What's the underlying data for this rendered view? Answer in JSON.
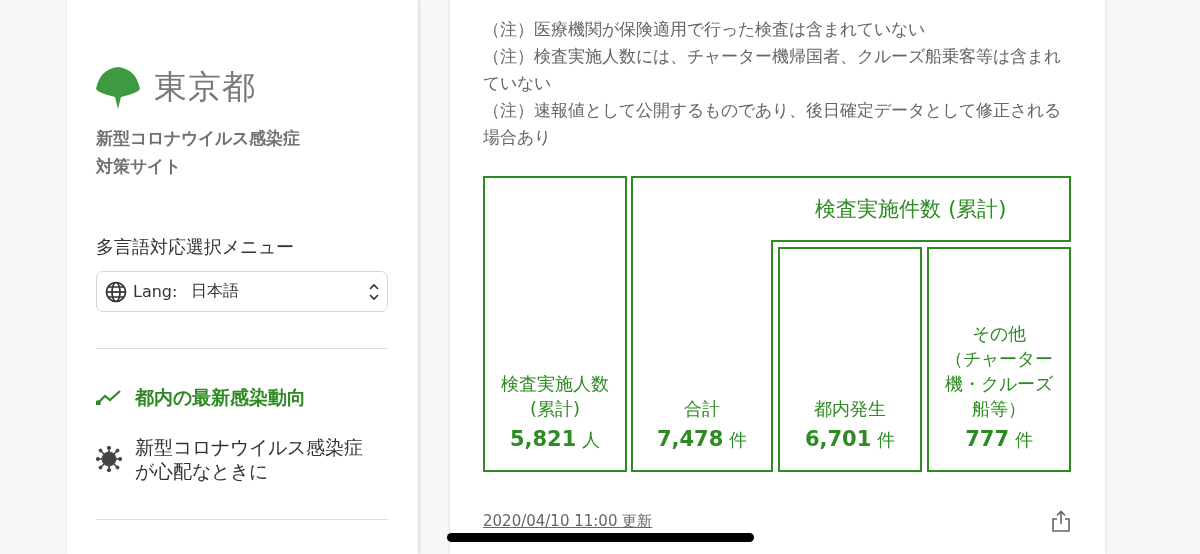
{
  "sidebar": {
    "logo_text": "東京都",
    "site_title_lines": [
      "新型コロナウイルス感染症",
      "対策サイト"
    ],
    "language_menu": {
      "label": "多言語対応選択メニュー",
      "prefix": "Lang:",
      "value": "日本語"
    },
    "nav_items": [
      {
        "label": "都内の最新感染動向",
        "kind": "trend",
        "selected": true
      },
      {
        "label": "新型コロナウイルス感染症が心配なときに",
        "kind": "virus",
        "selected": false
      }
    ]
  },
  "card": {
    "notes": [
      "（注）医療機関が保険適用で行った検査は含まれていない",
      "（注）検査実施人数には、チャーター機帰国者、クルーズ船乗客等は含まれていない",
      "（注）速報値として公開するものであり、後日確定データとして修正される場合あり"
    ],
    "people": {
      "label_lines": [
        "検査実施人数",
        "(累計)"
      ],
      "value": "5,821",
      "unit": "人"
    },
    "group_title": "検査実施件数 (累計)",
    "total": {
      "label_lines": [
        "合計"
      ],
      "value": "7,478",
      "unit": "件"
    },
    "breakdown": [
      {
        "label_lines": [
          "都内発生"
        ],
        "value": "6,701",
        "unit": "件"
      },
      {
        "label_lines": [
          "その他",
          "（チャーター",
          "機・クルーズ",
          "船等）"
        ],
        "value": "777",
        "unit": "件"
      }
    ],
    "updated": "2020/04/10 11:00 更新"
  }
}
